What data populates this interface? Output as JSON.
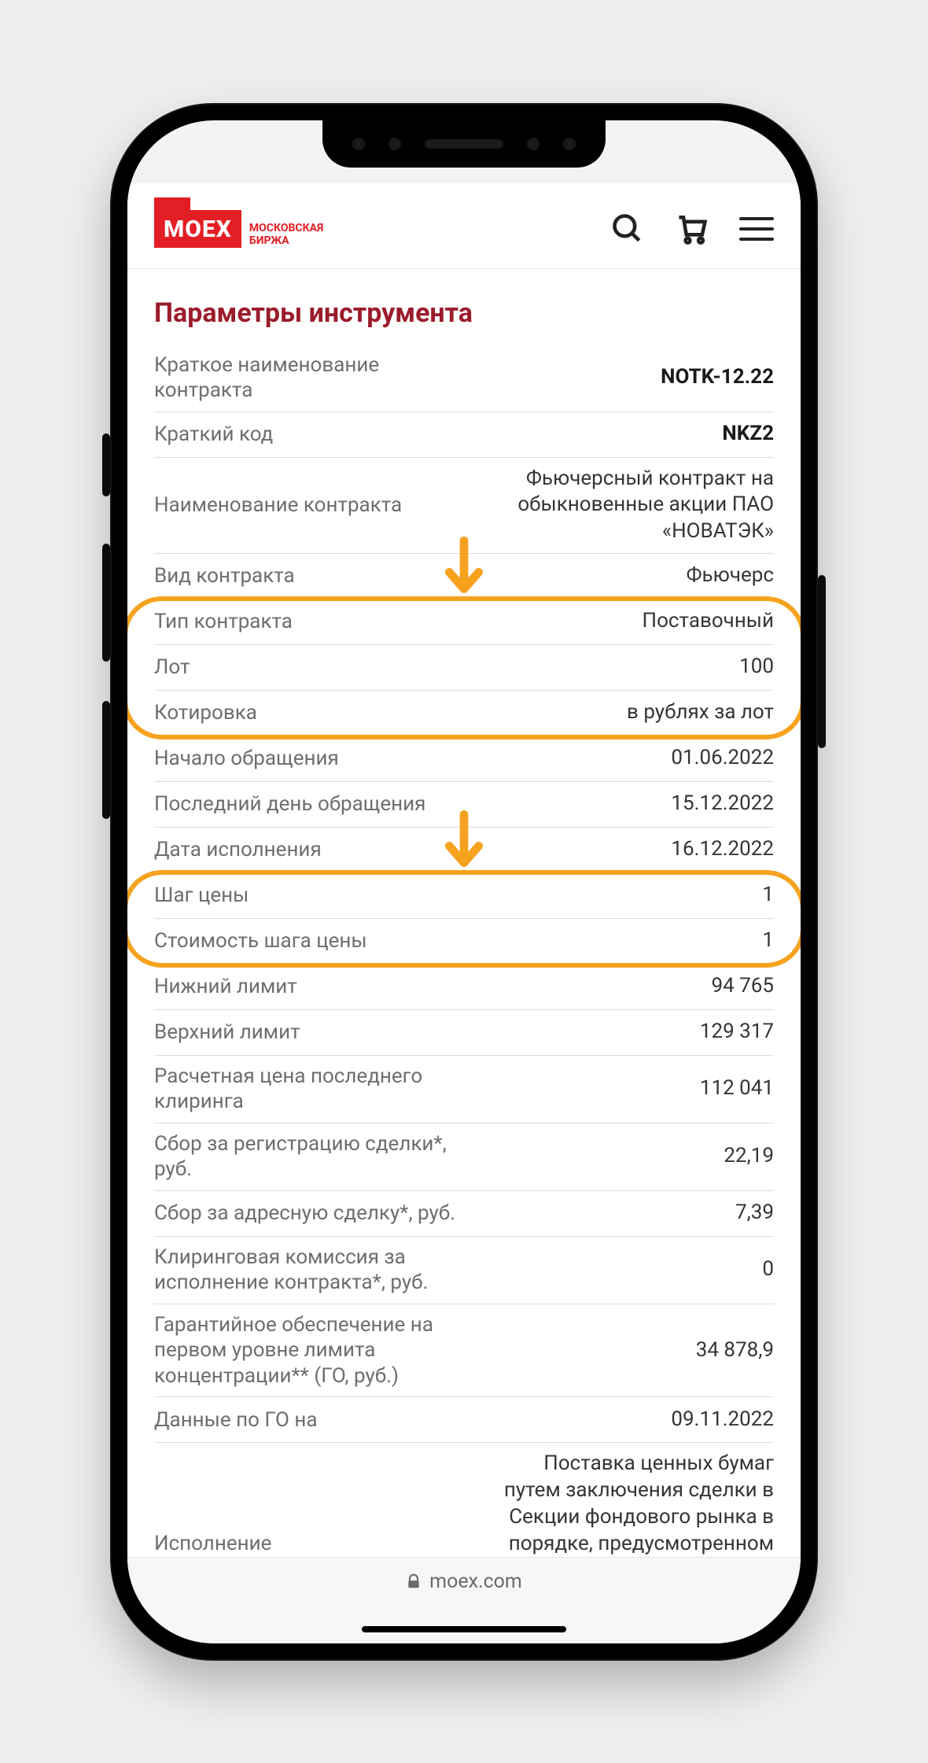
{
  "logo": {
    "mark": "MOEX",
    "sub1": "МОСКОВСКАЯ",
    "sub2": "БИРЖА"
  },
  "section_title": "Параметры инструмента",
  "rows": [
    {
      "label": "Краткое наименование контракта",
      "value": "NOTK-12.22",
      "bold": true
    },
    {
      "label": "Краткий код",
      "value": "NKZ2",
      "bold": true
    },
    {
      "label": "Наименование контракта",
      "value": "Фьючерсный контракт на обыкновенные акции ПАО «НОВАТЭК»"
    },
    {
      "label": "Вид контракта",
      "value": "Фьючерс"
    },
    {
      "label": "Тип контракта",
      "value": "Поставочный"
    },
    {
      "label": "Лот",
      "value": "100"
    },
    {
      "label": "Котировка",
      "value": "в рублях за лот"
    },
    {
      "label": "Начало обращения",
      "value": "01.06.2022"
    },
    {
      "label": "Последний день обращения",
      "value": "15.12.2022"
    },
    {
      "label": "Дата исполнения",
      "value": "16.12.2022"
    },
    {
      "label": "Шаг цены",
      "value": "1"
    },
    {
      "label": "Стоимость шага цены",
      "value": "1"
    },
    {
      "label": "Нижний лимит",
      "value": "94 765"
    },
    {
      "label": "Верхний лимит",
      "value": "129 317"
    },
    {
      "label": "Расчетная цена последнего клиринга",
      "value": "112 041"
    },
    {
      "label": "Сбор за регистрацию сделки*, руб.",
      "value": "22,19"
    },
    {
      "label": "Сбор за адресную сделку*, руб.",
      "value": "7,39"
    },
    {
      "label": "Клиринговая комиссия за исполнение контракта*, руб.",
      "value": "0"
    },
    {
      "label": "Гарантийное обеспечение на первом уровне лимита концентрации** (ГО, руб.)",
      "value": "34 878,9"
    },
    {
      "label": "Данные по ГО на",
      "value": "09.11.2022"
    },
    {
      "label": "Исполнение",
      "value": "Поставка ценных бумаг путем заключения сделки в Секции фондового рынка в порядке, предусмотренном Правилами проведения торгов на фондовом рынке ПАО Московская Биржа (до"
    }
  ],
  "browser": {
    "host": "moex.com"
  },
  "annotations": {
    "highlight1_rows": [
      4,
      5,
      6
    ],
    "highlight2_rows": [
      10,
      11
    ]
  }
}
